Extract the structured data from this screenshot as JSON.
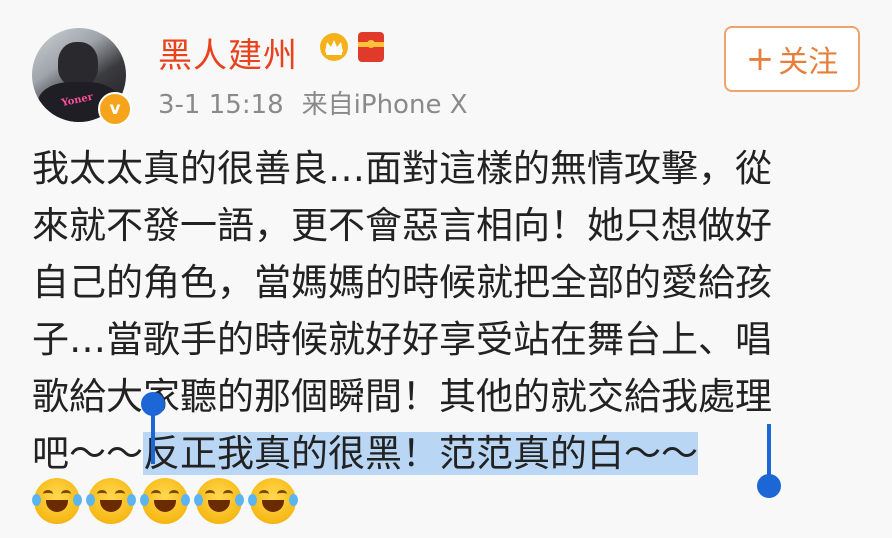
{
  "post": {
    "username": "黑人建州",
    "date": "3-1 15:18",
    "source": "来自iPhone X",
    "follow_label": "关注",
    "follow_plus": "+",
    "avatar_shirt_text": "Yoner",
    "verified_mark": "v",
    "lines": [
      "我太太真的很善良…面對這樣的無情攻擊，從",
      "來就不發一語，更不會惡言相向！她只想做好",
      "自己的角色，當媽媽的時候就把全部的愛給孩",
      "子…當歌手的時候就好好享受站在舞台上、唱",
      "歌給大家聽的那個瞬間！其他的就交給我處理"
    ],
    "last_line_before_selection": "吧～～",
    "selected_text": "反正我真的很黑！范范真的白～～",
    "emoji_count": 5,
    "emoji_name": "laugh-cry-emoji"
  }
}
